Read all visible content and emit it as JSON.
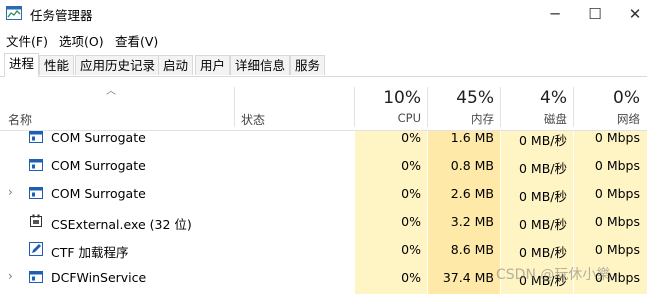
{
  "window": {
    "title": "任务管理器",
    "controls": {
      "minimize": "─",
      "maximize": "☐",
      "close": "✕"
    }
  },
  "menu": [
    "文件(F)",
    "选项(O)",
    "查看(V)"
  ],
  "tabs": [
    "进程",
    "性能",
    "应用历史记录",
    "启动",
    "用户",
    "详细信息",
    "服务"
  ],
  "active_tab": "进程",
  "columns": {
    "name": "名称",
    "status": "状态",
    "cpu": {
      "percent": "10%",
      "label": "CPU"
    },
    "memory": {
      "percent": "45%",
      "label": "内存"
    },
    "disk": {
      "percent": "4%",
      "label": "磁盘"
    },
    "network": {
      "percent": "0%",
      "label": "网络"
    }
  },
  "processes": [
    {
      "name": "COM Surrogate",
      "cpu": "0%",
      "memory": "1.6 MB",
      "disk": "0 MB/秒",
      "network": "0 Mbps",
      "expandable": false,
      "icon": "window-icon"
    },
    {
      "name": "COM Surrogate",
      "cpu": "0%",
      "memory": "0.8 MB",
      "disk": "0 MB/秒",
      "network": "0 Mbps",
      "expandable": false,
      "icon": "window-icon"
    },
    {
      "name": "COM Surrogate",
      "cpu": "0%",
      "memory": "2.6 MB",
      "disk": "0 MB/秒",
      "network": "0 Mbps",
      "expandable": true,
      "icon": "window-icon"
    },
    {
      "name": "CSExternal.exe (32 位)",
      "cpu": "0%",
      "memory": "3.2 MB",
      "disk": "0 MB/秒",
      "network": "0 Mbps",
      "expandable": false,
      "icon": "app-exe-icon"
    },
    {
      "name": "CTF 加载程序",
      "cpu": "0%",
      "memory": "8.6 MB",
      "disk": "0 MB/秒",
      "network": "0 Mbps",
      "expandable": false,
      "icon": "pen-icon"
    },
    {
      "name": "DCFWinService",
      "cpu": "0%",
      "memory": "37.4 MB",
      "disk": "0 MB/秒",
      "network": "0 Mbps",
      "expandable": true,
      "icon": "window-icon"
    }
  ],
  "watermark": "CSDN @玩休小樂",
  "colors": {
    "cpu_bg": "#fff4c4",
    "mem_bg": "#ffe9a8",
    "other_bg": "#fff4c4"
  }
}
